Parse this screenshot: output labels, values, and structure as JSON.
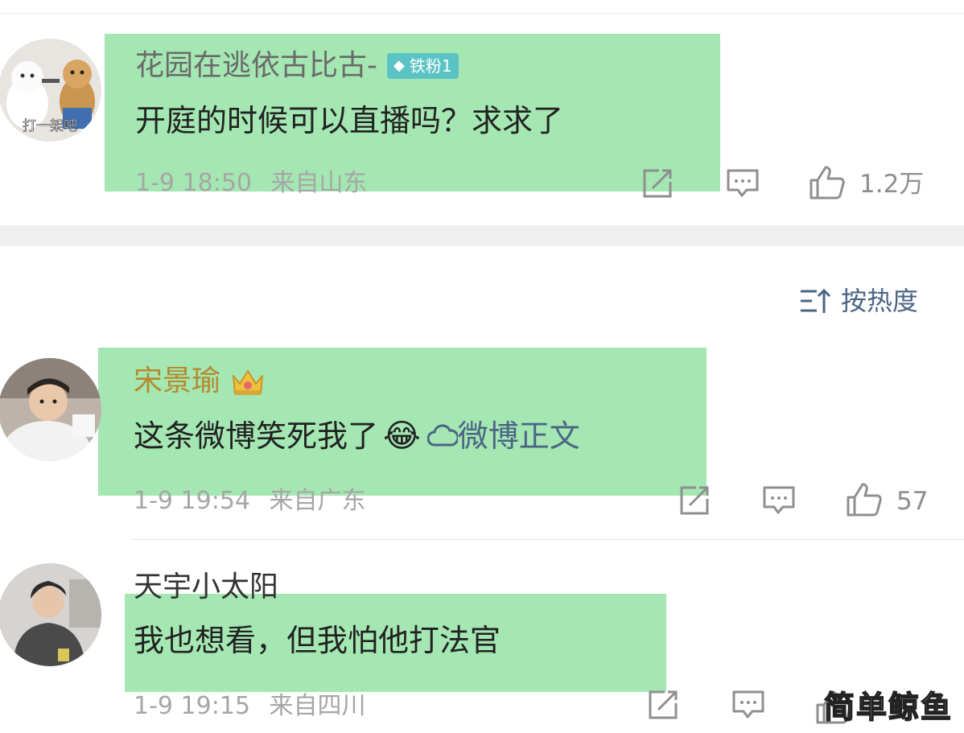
{
  "comments": [
    {
      "username": "花园在逃依古比古-",
      "badge": "铁粉1",
      "avatar_caption": "打一架吧",
      "text": "开庭的时候可以直播吗？求求了",
      "time": "1-9 18:50",
      "location": "来自山东",
      "likes": "1.2万"
    },
    {
      "username": "宋景瑜",
      "text": "这条微博笑死我了",
      "emoji": "😂",
      "link_label": "微博正文",
      "time": "1-9 19:54",
      "location": "来自广东",
      "likes": "57"
    },
    {
      "username": "天宇小太阳",
      "text": "我也想看，但我怕他打法官",
      "time": "1-9 19:15",
      "location": "来自四川"
    }
  ],
  "sort": {
    "label": "按热度"
  },
  "watermark": "简单鲸鱼",
  "icons": [
    "share-icon",
    "comment-icon",
    "like-icon",
    "sort-icon",
    "crown-icon",
    "weibo-link-icon"
  ],
  "colors": {
    "highlight": "#8be09c",
    "link": "#4b6585",
    "badge": "#5cc3c4",
    "username_vip": "#b5892e"
  }
}
